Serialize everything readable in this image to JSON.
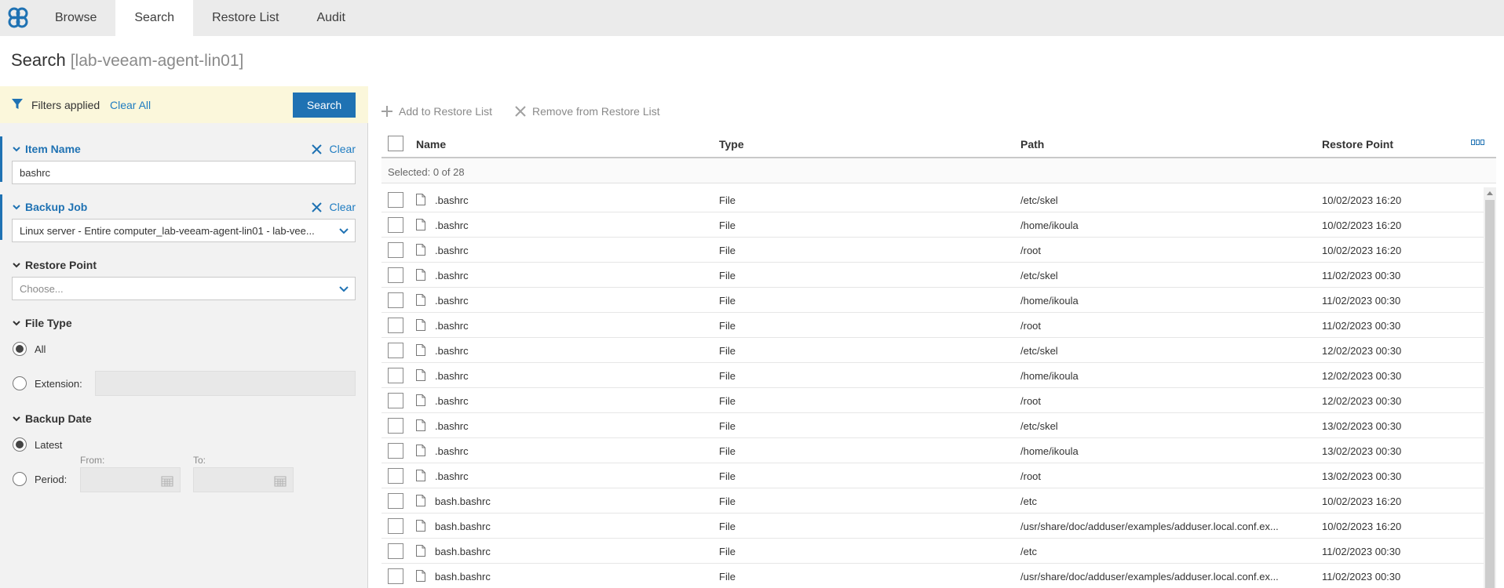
{
  "nav": {
    "tabs": [
      {
        "label": "Browse",
        "active": false
      },
      {
        "label": "Search",
        "active": true
      },
      {
        "label": "Restore List",
        "active": false
      },
      {
        "label": "Audit",
        "active": false
      }
    ]
  },
  "page": {
    "title": "Search",
    "subtitle": "[lab-veeam-agent-lin01]"
  },
  "filters": {
    "applied_label": "Filters applied",
    "clear_all_label": "Clear All",
    "search_button": "Search",
    "item_name": {
      "label": "Item Name",
      "clear_label": "Clear",
      "value": "bashrc"
    },
    "backup_job": {
      "label": "Backup Job",
      "clear_label": "Clear",
      "value": "Linux server - Entire computer_lab-veeam-agent-lin01 - lab-vee..."
    },
    "restore_point": {
      "label": "Restore Point",
      "placeholder": "Choose..."
    },
    "file_type": {
      "label": "File Type",
      "option_all": "All",
      "option_extension": "Extension:",
      "selected": "All"
    },
    "backup_date": {
      "label": "Backup Date",
      "option_latest": "Latest",
      "option_period": "Period:",
      "from_label": "From:",
      "to_label": "To:",
      "selected": "Latest"
    }
  },
  "toolbar": {
    "add_label": "Add to Restore List",
    "remove_label": "Remove from Restore List"
  },
  "grid": {
    "columns": {
      "name": "Name",
      "type": "Type",
      "path": "Path",
      "restore_point": "Restore Point"
    },
    "selected_text": "Selected: 0 of 28",
    "rows": [
      {
        "name": ".bashrc",
        "type": "File",
        "path": "/etc/skel",
        "restore_point": "10/02/2023 16:20"
      },
      {
        "name": ".bashrc",
        "type": "File",
        "path": "/home/ikoula",
        "restore_point": "10/02/2023 16:20"
      },
      {
        "name": ".bashrc",
        "type": "File",
        "path": "/root",
        "restore_point": "10/02/2023 16:20"
      },
      {
        "name": ".bashrc",
        "type": "File",
        "path": "/etc/skel",
        "restore_point": "11/02/2023 00:30"
      },
      {
        "name": ".bashrc",
        "type": "File",
        "path": "/home/ikoula",
        "restore_point": "11/02/2023 00:30"
      },
      {
        "name": ".bashrc",
        "type": "File",
        "path": "/root",
        "restore_point": "11/02/2023 00:30"
      },
      {
        "name": ".bashrc",
        "type": "File",
        "path": "/etc/skel",
        "restore_point": "12/02/2023 00:30"
      },
      {
        "name": ".bashrc",
        "type": "File",
        "path": "/home/ikoula",
        "restore_point": "12/02/2023 00:30"
      },
      {
        "name": ".bashrc",
        "type": "File",
        "path": "/root",
        "restore_point": "12/02/2023 00:30"
      },
      {
        "name": ".bashrc",
        "type": "File",
        "path": "/etc/skel",
        "restore_point": "13/02/2023 00:30"
      },
      {
        "name": ".bashrc",
        "type": "File",
        "path": "/home/ikoula",
        "restore_point": "13/02/2023 00:30"
      },
      {
        "name": ".bashrc",
        "type": "File",
        "path": "/root",
        "restore_point": "13/02/2023 00:30"
      },
      {
        "name": "bash.bashrc",
        "type": "File",
        "path": "/etc",
        "restore_point": "10/02/2023 16:20"
      },
      {
        "name": "bash.bashrc",
        "type": "File",
        "path": "/usr/share/doc/adduser/examples/adduser.local.conf.ex...",
        "restore_point": "10/02/2023 16:20"
      },
      {
        "name": "bash.bashrc",
        "type": "File",
        "path": "/etc",
        "restore_point": "11/02/2023 00:30"
      },
      {
        "name": "bash.bashrc",
        "type": "File",
        "path": "/usr/share/doc/adduser/examples/adduser.local.conf.ex...",
        "restore_point": "11/02/2023 00:30"
      }
    ]
  },
  "colors": {
    "accent": "#1f72b3",
    "link": "#1f7cc1",
    "filter_bar": "#fbf7db"
  },
  "icons": [
    "app-logo-icon",
    "filter-icon",
    "close-icon",
    "chevron-down-icon",
    "plus-icon",
    "calendar-icon",
    "file-icon",
    "column-menu-icon"
  ]
}
